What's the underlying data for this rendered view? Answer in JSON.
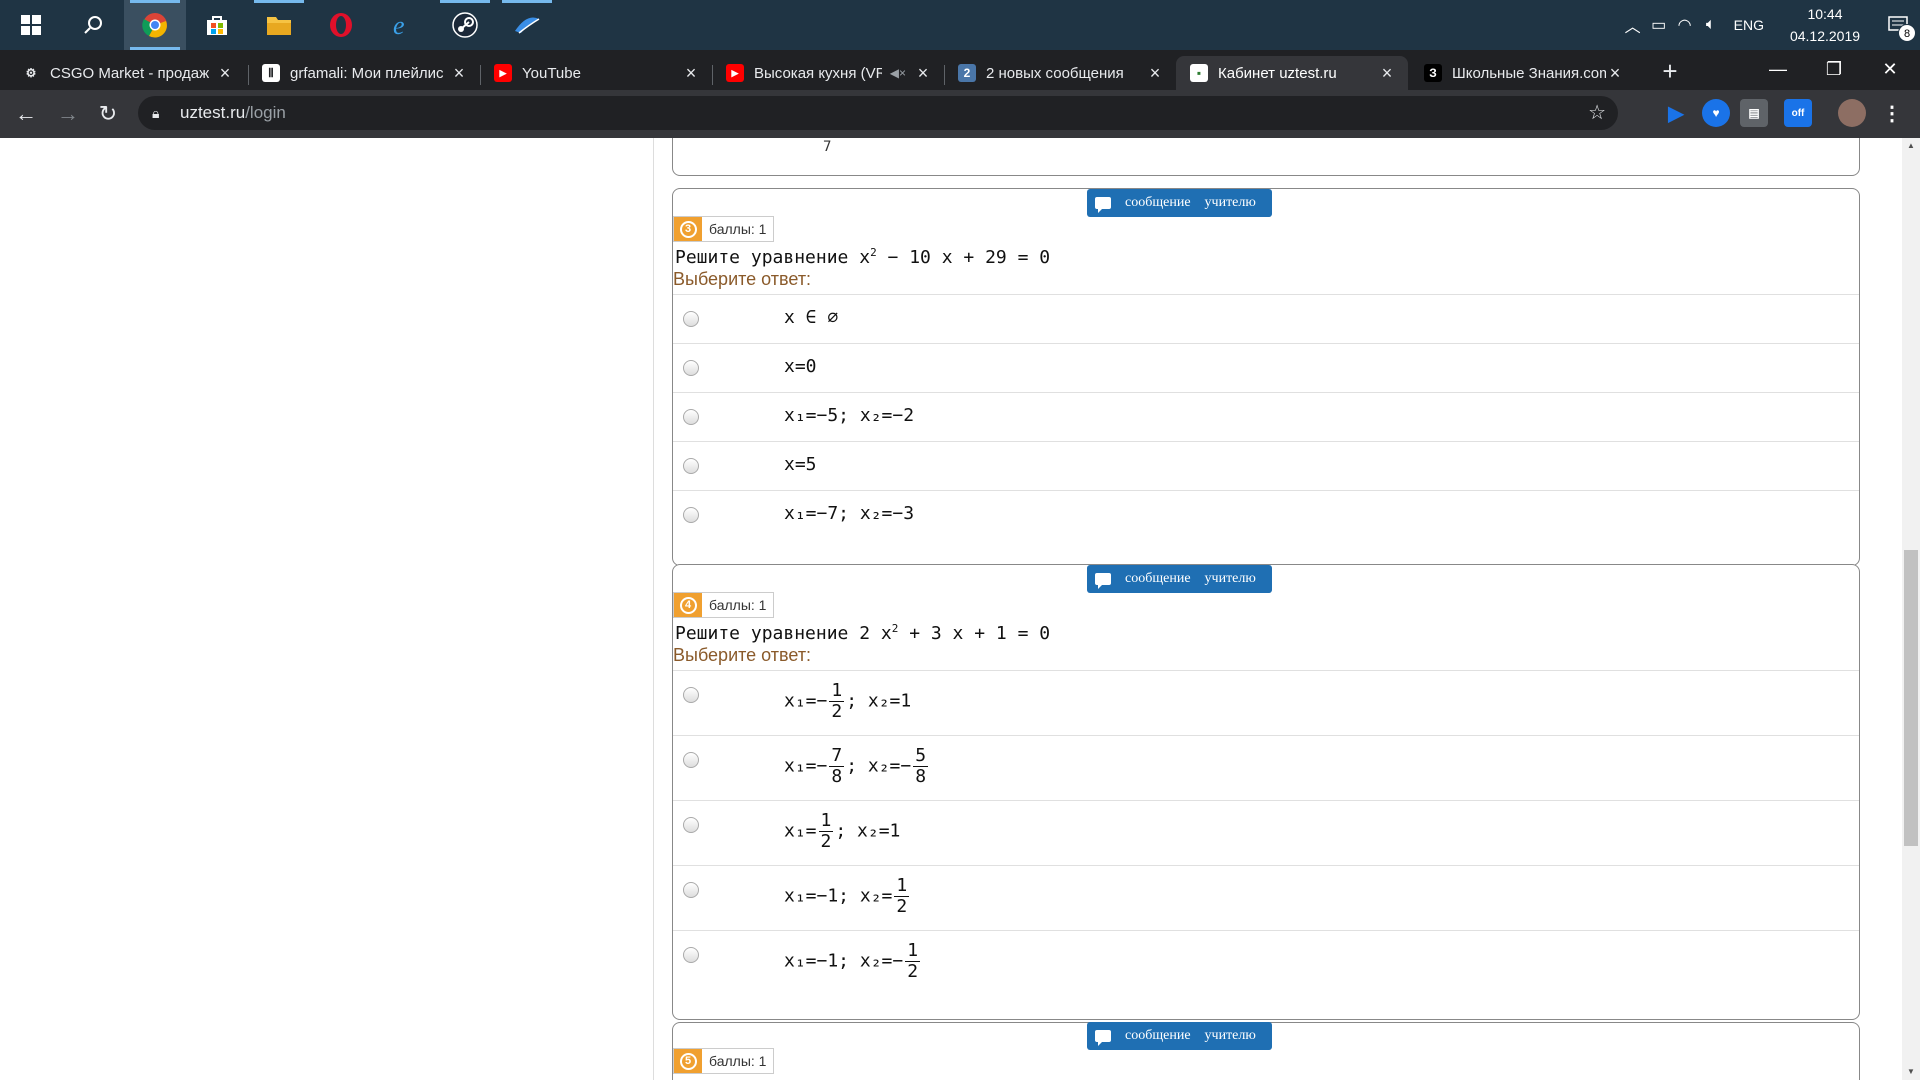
{
  "taskbar": {
    "apps": [
      "start",
      "search",
      "chrome",
      "store",
      "explorer",
      "opera",
      "edge",
      "steam",
      "app"
    ],
    "lang": "ENG",
    "time": "10:44",
    "date": "04.12.2019",
    "notifications": "8"
  },
  "browser": {
    "tabs": [
      {
        "title": "CSGO Market - продаж",
        "fav": "⚙"
      },
      {
        "title": "grfamali: Мои плейлис",
        "fav": "Ⅱ"
      },
      {
        "title": "YouTube",
        "fav": "▶"
      },
      {
        "title": "Высокая кухня (VR",
        "fav": "▶"
      },
      {
        "title": "2 новых сообщения",
        "fav": "2"
      },
      {
        "title": "Кабинет uztest.ru",
        "fav": "▪"
      },
      {
        "title": "Школьные Знания.com",
        "fav": "З"
      }
    ],
    "url_host": "uztest.ru",
    "url_path": "/login"
  },
  "page": {
    "msg_btn_1": "сообщение",
    "msg_btn_2": "учителю",
    "score_label": "баллы: 1",
    "choose_label": "Выберите ответ:",
    "prev_fragment": "7",
    "q3": {
      "num": "3",
      "text_a": "Решите уравнение x",
      "text_sup": "2",
      "text_b": " − 10 x + 29 = 0",
      "answers": {
        "a1": "x ∈ ∅",
        "a2": "x=0",
        "a3": "x₁=−5;  x₂=−2",
        "a4": "x=5",
        "a5": "x₁=−7;  x₂=−3"
      }
    },
    "q4": {
      "num": "4",
      "text_a": "Решите уравнение 2 x",
      "text_sup": "2",
      "text_b": " + 3 x + 1 = 0",
      "answers": {
        "a1_pre": "x₁=−",
        "a1_n": "1",
        "a1_d": "2",
        "a1_post": ";  x₂=1",
        "a2_pre": "x₁=−",
        "a2_n": "7",
        "a2_d": "8",
        "a2_mid": ";  x₂=−",
        "a2_n2": "5",
        "a2_d2": "8",
        "a3_pre": "x₁=",
        "a3_n": "1",
        "a3_d": "2",
        "a3_post": ";  x₂=1",
        "a4_pre": "x₁=−1;  x₂=",
        "a4_n": "1",
        "a4_d": "2",
        "a5_pre": "x₁=−1;  x₂=−",
        "a5_n": "1",
        "a5_d": "2"
      }
    },
    "q5": {
      "num": "5"
    }
  }
}
